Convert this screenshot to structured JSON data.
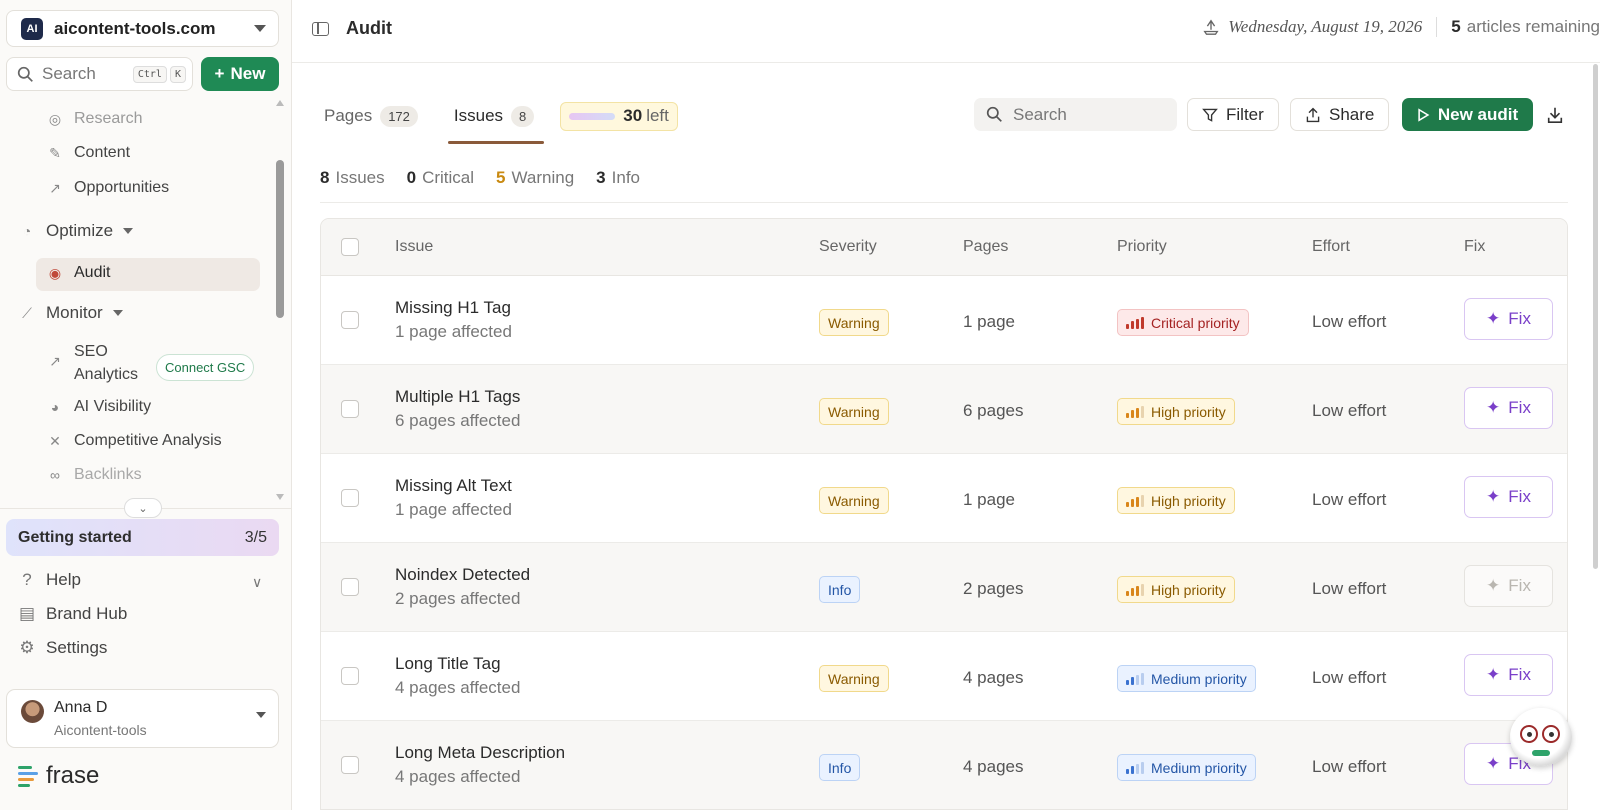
{
  "workspace": {
    "logo_text": "AI",
    "name": "aicontent-tools.com"
  },
  "sidebar": {
    "search_label": "Search",
    "shortcut_keys": [
      "Ctrl",
      "K"
    ],
    "new_label": "New",
    "research": "Research",
    "content": "Content",
    "opportunities": "Opportunities",
    "optimize": "Optimize",
    "audit": "Audit",
    "monitor": "Monitor",
    "seo_line1": "SEO",
    "seo_line2": "Analytics",
    "connect_gsc": "Connect GSC",
    "ai_visibility": "AI Visibility",
    "competitive": "Competitive Analysis",
    "backlinks": "Backlinks",
    "getting_started": {
      "label": "Getting started",
      "progress": "3/5"
    },
    "help": "Help",
    "brand_hub": "Brand Hub",
    "settings": "Settings",
    "user": {
      "name": "Anna D",
      "org": "Aicontent-tools"
    },
    "brand": "frase"
  },
  "topbar": {
    "title": "Audit",
    "date": "Wednesday, August 19, 2026",
    "articles_count": "5",
    "articles_label": "articles remaining"
  },
  "toolbar": {
    "tabs": [
      {
        "label": "Pages",
        "count": "172"
      },
      {
        "label": "Issues",
        "count": "8"
      }
    ],
    "credits_num": "30",
    "credits_label": "left",
    "search_placeholder": "Search",
    "filter": "Filter",
    "share": "Share",
    "new_audit": "New audit"
  },
  "summary": {
    "issues_count": "8",
    "issues_label": "Issues",
    "critical_count": "0",
    "critical_label": "Critical",
    "warning_count": "5",
    "warning_label": "Warning",
    "info_count": "3",
    "info_label": "Info"
  },
  "table": {
    "headers": {
      "issue": "Issue",
      "severity": "Severity",
      "pages": "Pages",
      "priority": "Priority",
      "effort": "Effort",
      "fix": "Fix"
    },
    "rows": [
      {
        "title": "Missing H1 Tag",
        "sub": "1 page affected",
        "severity": "Warning",
        "pages": "1 page",
        "priority": "Critical priority",
        "effort": "Low effort",
        "fix": "Fix"
      },
      {
        "title": "Multiple H1 Tags",
        "sub": "6 pages affected",
        "severity": "Warning",
        "pages": "6 pages",
        "priority": "High priority",
        "effort": "Low effort",
        "fix": "Fix"
      },
      {
        "title": "Missing Alt Text",
        "sub": "1 page affected",
        "severity": "Warning",
        "pages": "1 page",
        "priority": "High priority",
        "effort": "Low effort",
        "fix": "Fix"
      },
      {
        "title": "Noindex Detected",
        "sub": "2 pages affected",
        "severity": "Info",
        "pages": "2 pages",
        "priority": "High priority",
        "effort": "Low effort",
        "fix": "Fix"
      },
      {
        "title": "Long Title Tag",
        "sub": "4 pages affected",
        "severity": "Warning",
        "pages": "4 pages",
        "priority": "Medium priority",
        "effort": "Low effort",
        "fix": "Fix"
      },
      {
        "title": "Long Meta Description",
        "sub": "4 pages affected",
        "severity": "Info",
        "pages": "4 pages",
        "priority": "Medium priority",
        "effort": "Low effort",
        "fix": "Fix"
      }
    ]
  },
  "colors": {
    "brand_green": "#1f8a55",
    "fix_purple": "#7a3fc9",
    "critical_red": "#c0392b",
    "high_orange": "#d9861a",
    "medium_blue": "#3a72d0"
  }
}
